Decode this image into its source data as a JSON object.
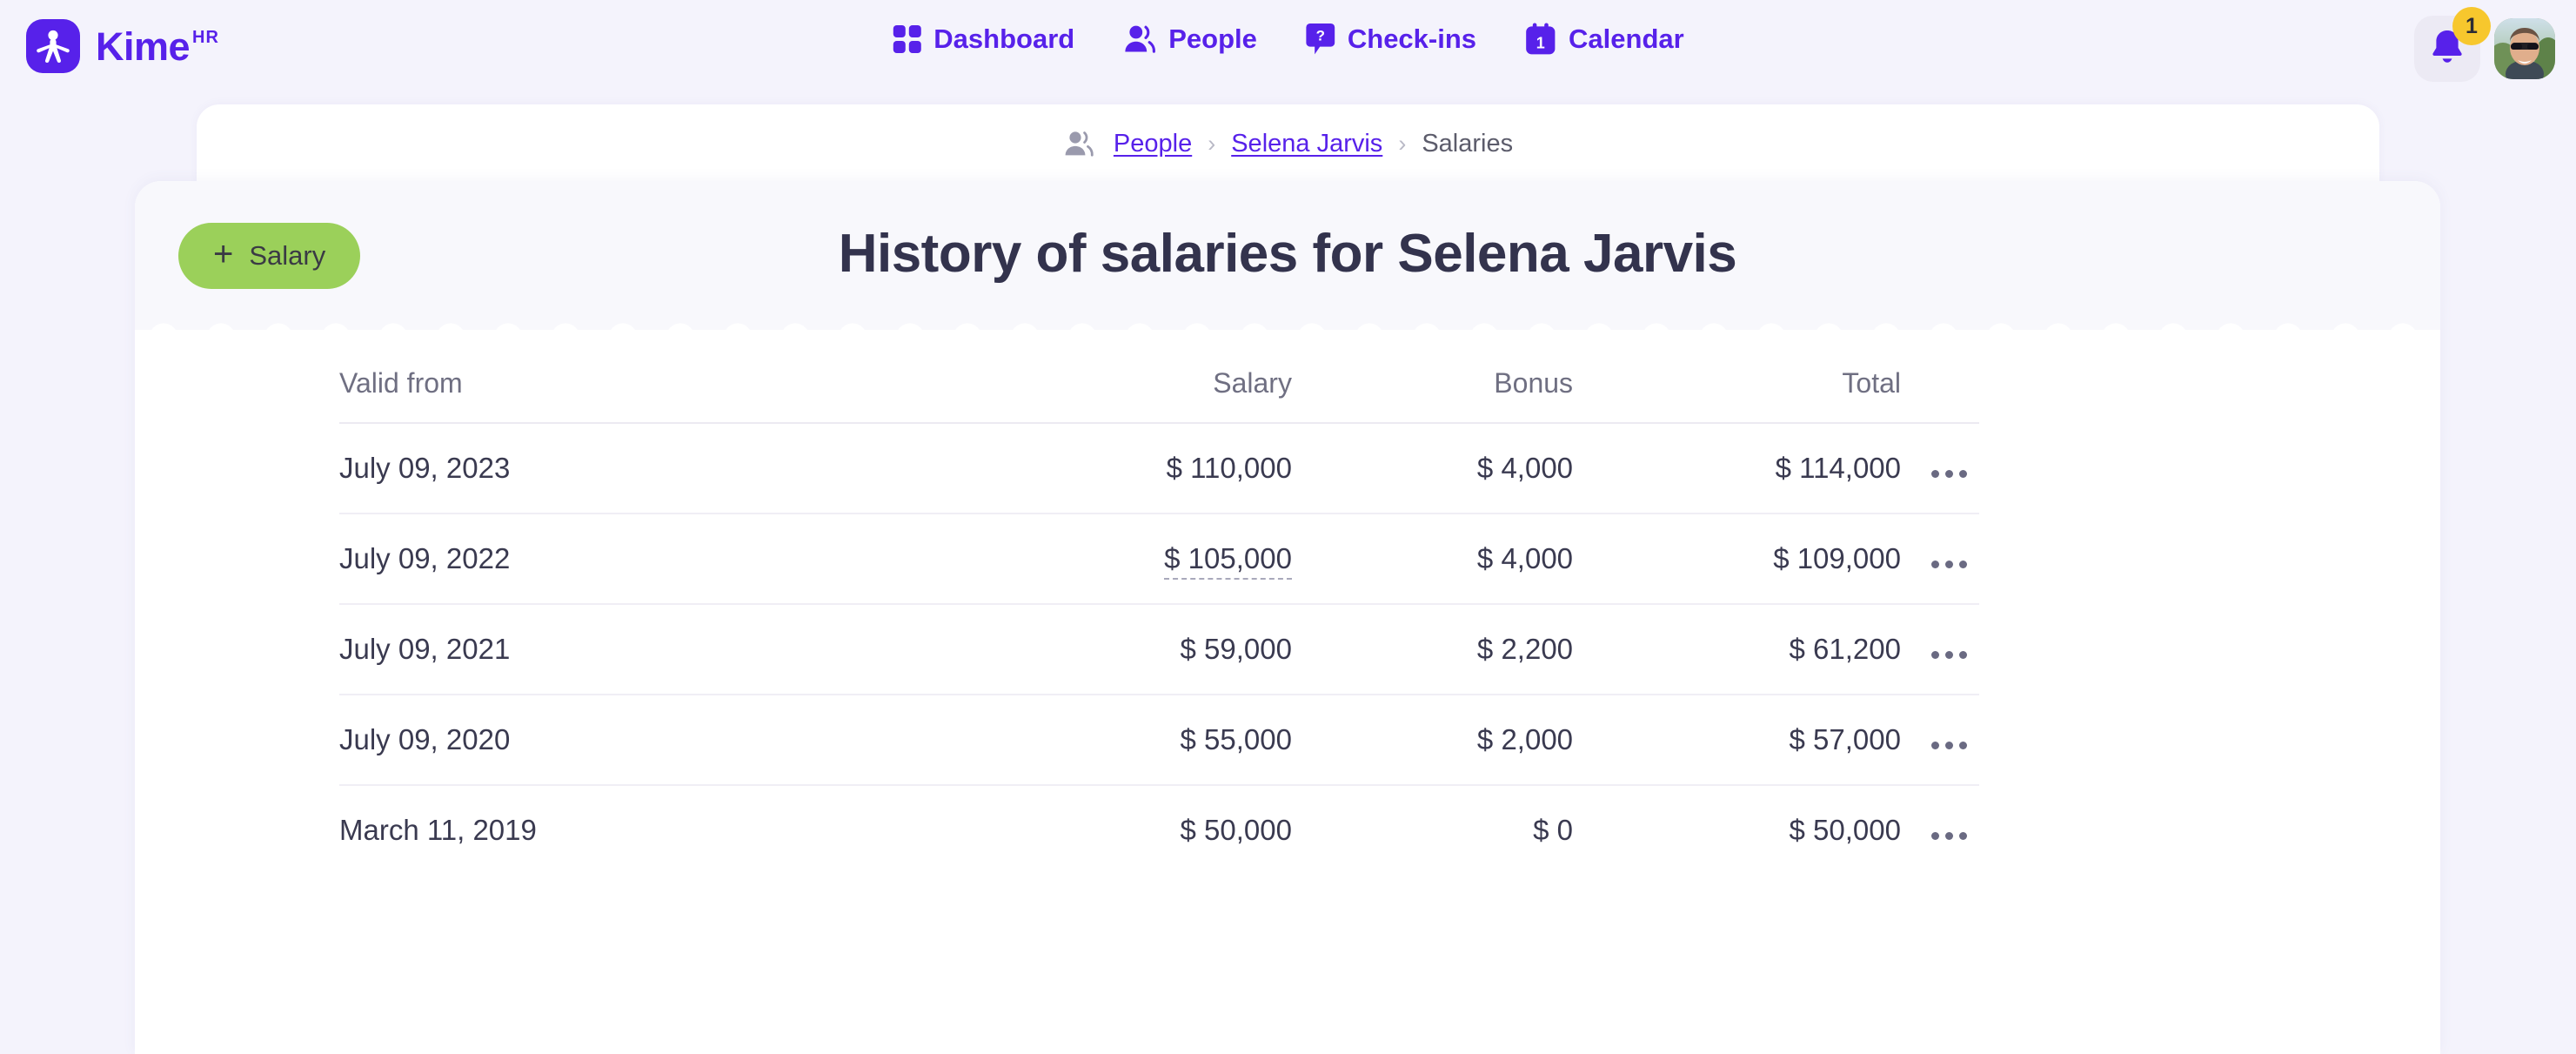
{
  "brand": {
    "name": "Kime",
    "superscript": "HR",
    "logo_icon": "person-figure-icon",
    "accent_color": "#5721ea"
  },
  "nav": {
    "items": [
      {
        "label": "Dashboard",
        "icon": "grid-icon"
      },
      {
        "label": "People",
        "icon": "people-icon"
      },
      {
        "label": "Check-ins",
        "icon": "question-bubble-icon"
      },
      {
        "label": "Calendar",
        "icon": "calendar-icon"
      }
    ]
  },
  "topright": {
    "notification_icon": "bell-icon",
    "notification_count": "1",
    "badge_color": "#f7c72d",
    "avatar_icon": "user-avatar"
  },
  "breadcrumb": {
    "icon": "people-icon",
    "items": [
      {
        "label": "People",
        "type": "link"
      },
      {
        "label": "Selena Jarvis",
        "type": "link"
      },
      {
        "label": "Salaries",
        "type": "current"
      }
    ],
    "separator": "›"
  },
  "header": {
    "add_button": {
      "label": "Salary",
      "plus": "+",
      "color": "#9bd05a"
    },
    "title": "History of salaries for Selena Jarvis"
  },
  "table": {
    "columns": [
      {
        "key": "valid_from",
        "label": "Valid from",
        "align": "left"
      },
      {
        "key": "salary",
        "label": "Salary",
        "align": "right"
      },
      {
        "key": "bonus",
        "label": "Bonus",
        "align": "right"
      },
      {
        "key": "total",
        "label": "Total",
        "align": "right"
      }
    ],
    "row_menu_icon": "more-horizontal-icon",
    "rows": [
      {
        "valid_from": "July 09, 2023",
        "salary": "$ 110,000",
        "bonus": "$ 4,000",
        "total": "$ 114,000",
        "salary_editing": false
      },
      {
        "valid_from": "July 09, 2022",
        "salary": "$ 105,000",
        "bonus": "$ 4,000",
        "total": "$ 109,000",
        "salary_editing": true
      },
      {
        "valid_from": "July 09, 2021",
        "salary": "$ 59,000",
        "bonus": "$ 2,200",
        "total": "$ 61,200",
        "salary_editing": false
      },
      {
        "valid_from": "July 09, 2020",
        "salary": "$ 55,000",
        "bonus": "$ 2,000",
        "total": "$ 57,000",
        "salary_editing": false
      },
      {
        "valid_from": "March 11, 2019",
        "salary": "$ 50,000",
        "bonus": "$ 0",
        "total": "$ 50,000",
        "salary_editing": false
      }
    ]
  }
}
